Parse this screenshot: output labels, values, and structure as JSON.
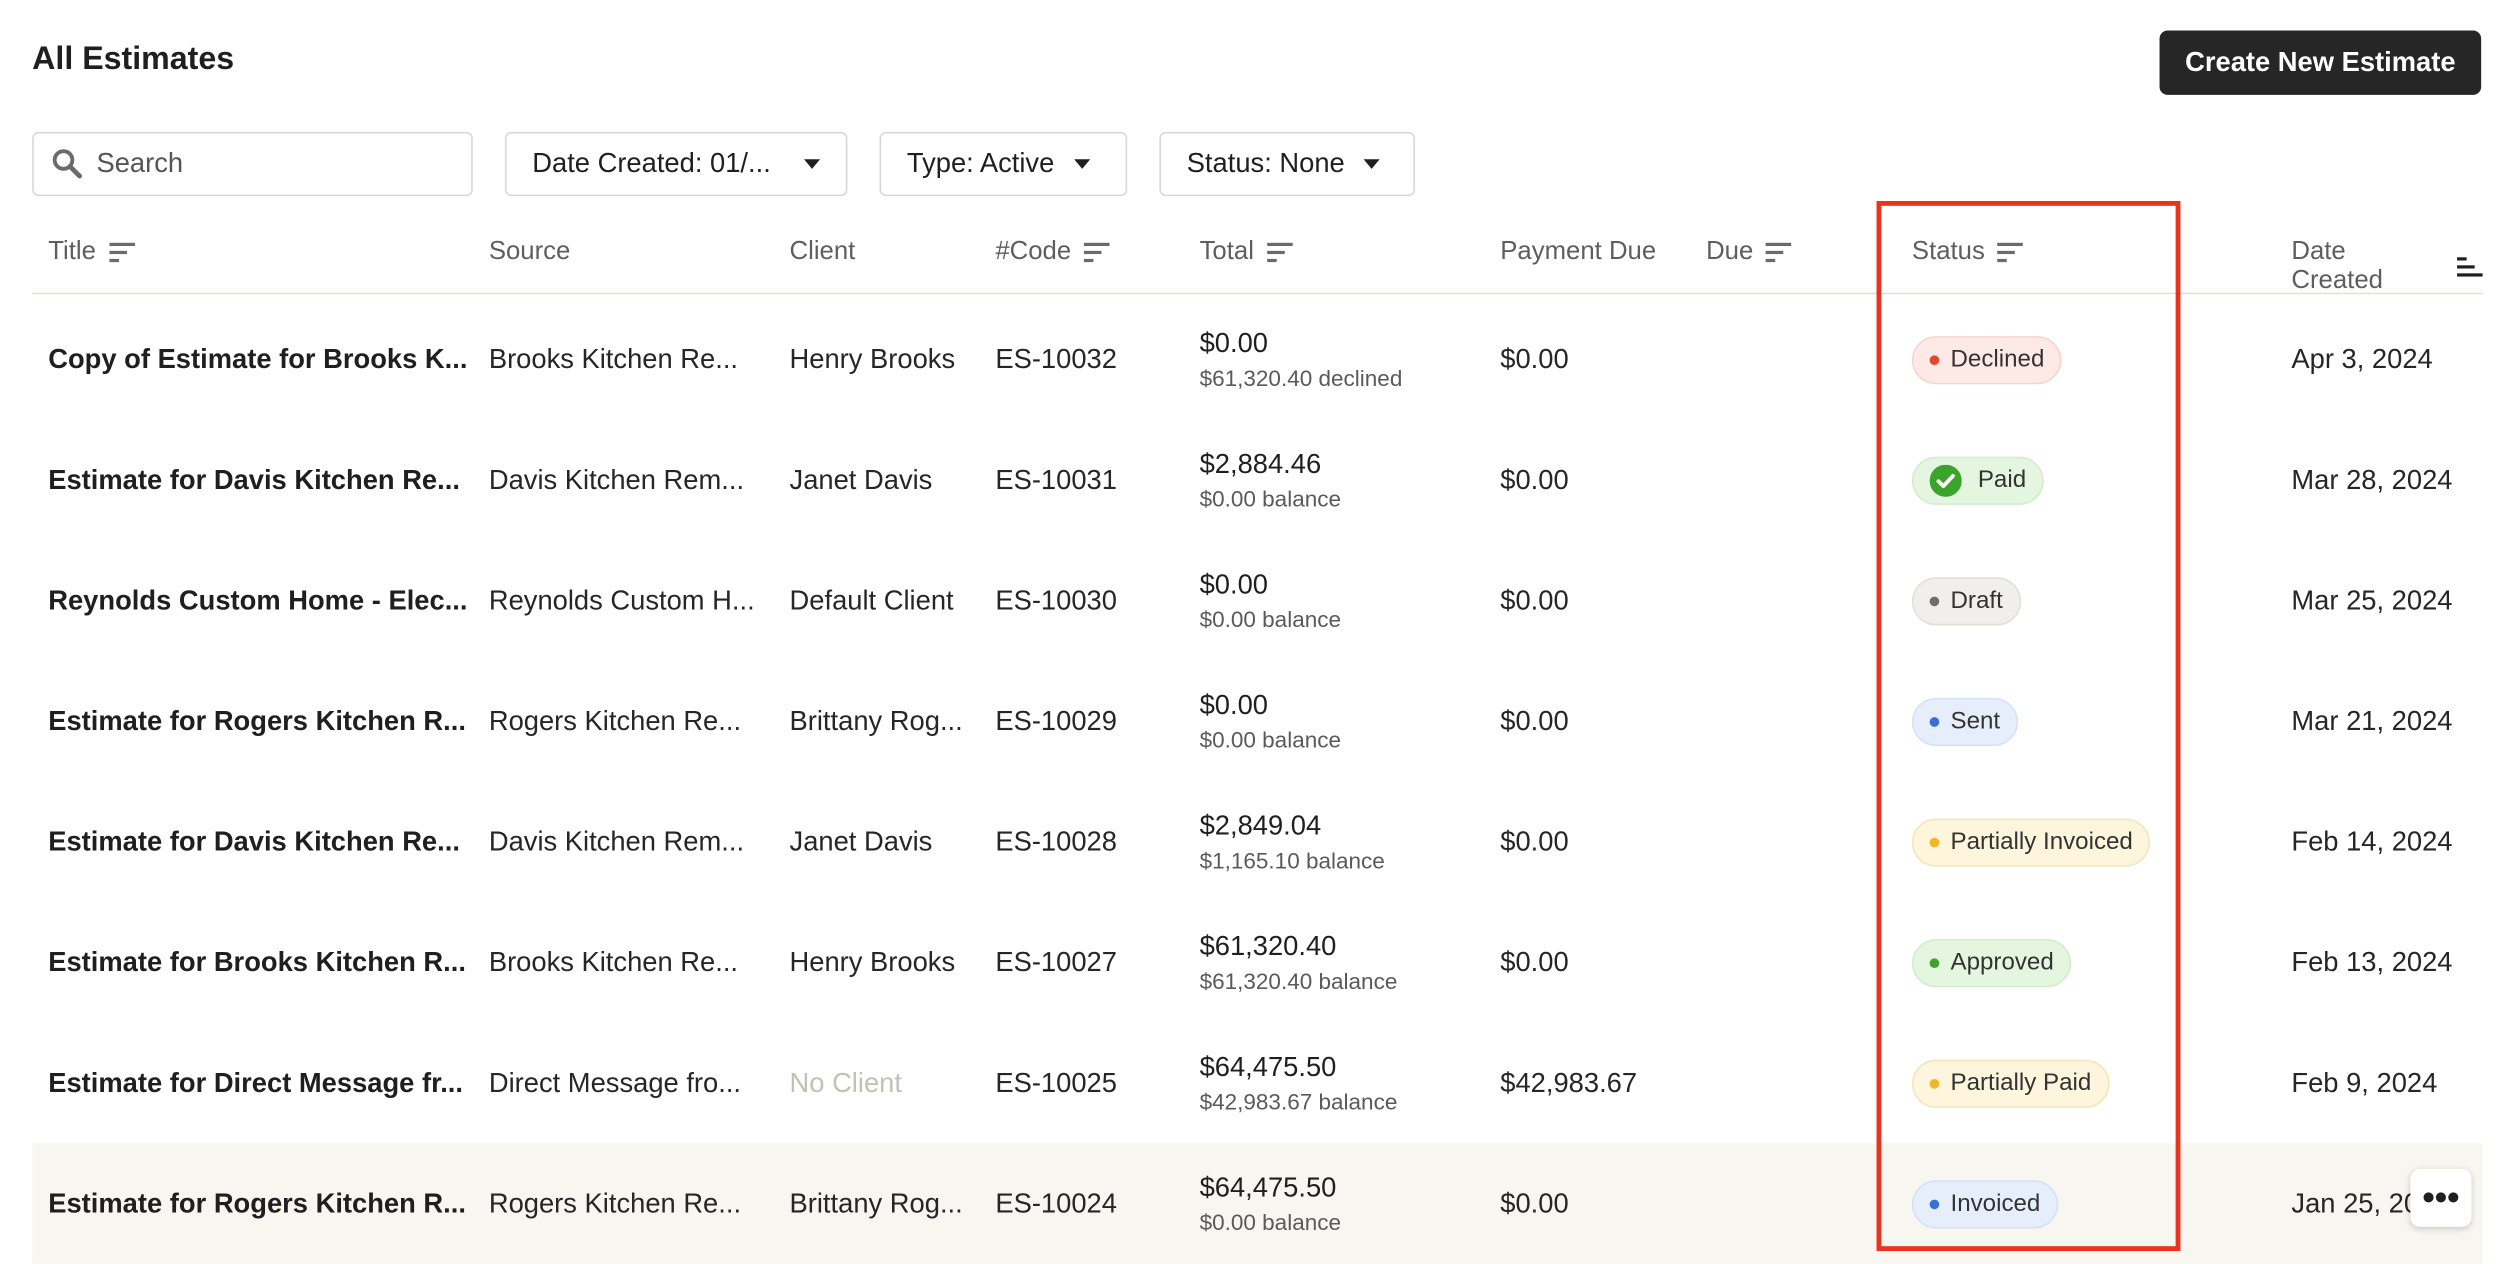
{
  "header": {
    "title": "All Estimates",
    "create_label": "Create New Estimate"
  },
  "search": {
    "placeholder": "Search"
  },
  "filters": {
    "date": "Date Created: 01/...",
    "type": "Type: Active",
    "status": "Status: None"
  },
  "columns": {
    "title": "Title",
    "source": "Source",
    "client": "Client",
    "code": "#Code",
    "total": "Total",
    "payment_due": "Payment Due",
    "due": "Due",
    "status": "Status",
    "date_created": "Date Created"
  },
  "status_colors": {
    "Declined": {
      "bg": "#fde9e6",
      "dot": "#e0482f",
      "border": "#f6d4cf"
    },
    "Paid": {
      "bg": "#e5f6e0",
      "dot": "#3ba42a",
      "border": "#d3edcb"
    },
    "Draft": {
      "bg": "#f0efeb",
      "dot": "#6d6d6d",
      "border": "#e2e0da"
    },
    "Sent": {
      "bg": "#e6eefb",
      "dot": "#3a6fd6",
      "border": "#d5e1f5"
    },
    "Partially Invoiced": {
      "bg": "#fdf5dc",
      "dot": "#f1b52a",
      "border": "#f3e6bd"
    },
    "Approved": {
      "bg": "#e5f6e0",
      "dot": "#3ba42a",
      "border": "#d3edcb"
    },
    "Partially Paid": {
      "bg": "#fdf5dc",
      "dot": "#f1b52a",
      "border": "#f3e6bd"
    },
    "Invoiced": {
      "bg": "#e6eefb",
      "dot": "#3a6fd6",
      "border": "#d5e1f5"
    }
  },
  "rows": [
    {
      "title": "Copy of Estimate for Brooks K...",
      "source": "Brooks Kitchen Re...",
      "client": "Henry Brooks",
      "client_muted": false,
      "code": "ES-10032",
      "total": "$0.00",
      "total_sub": "$61,320.40 declined",
      "payment_due": "$0.00",
      "due": "",
      "status": "Declined",
      "date": "Apr 3, 2024"
    },
    {
      "title": "Estimate for Davis Kitchen Re...",
      "source": "Davis Kitchen Rem...",
      "client": "Janet Davis",
      "client_muted": false,
      "code": "ES-10031",
      "total": "$2,884.46",
      "total_sub": "$0.00 balance",
      "payment_due": "$0.00",
      "due": "",
      "status": "Paid",
      "date": "Mar 28, 2024"
    },
    {
      "title": "Reynolds Custom Home - Elec...",
      "source": "Reynolds Custom H...",
      "client": "Default Client",
      "client_muted": false,
      "code": "ES-10030",
      "total": "$0.00",
      "total_sub": "$0.00 balance",
      "payment_due": "$0.00",
      "due": "",
      "status": "Draft",
      "date": "Mar 25, 2024"
    },
    {
      "title": "Estimate for Rogers Kitchen R...",
      "source": "Rogers Kitchen Re...",
      "client": "Brittany Rog...",
      "client_muted": false,
      "code": "ES-10029",
      "total": "$0.00",
      "total_sub": "$0.00 balance",
      "payment_due": "$0.00",
      "due": "",
      "status": "Sent",
      "date": "Mar 21, 2024"
    },
    {
      "title": "Estimate for Davis Kitchen Re...",
      "source": "Davis Kitchen Rem...",
      "client": "Janet Davis",
      "client_muted": false,
      "code": "ES-10028",
      "total": "$2,849.04",
      "total_sub": "$1,165.10 balance",
      "payment_due": "$0.00",
      "due": "",
      "status": "Partially Invoiced",
      "date": "Feb 14, 2024"
    },
    {
      "title": "Estimate for Brooks Kitchen R...",
      "source": "Brooks Kitchen Re...",
      "client": "Henry Brooks",
      "client_muted": false,
      "code": "ES-10027",
      "total": "$61,320.40",
      "total_sub": "$61,320.40 balance",
      "payment_due": "$0.00",
      "due": "",
      "status": "Approved",
      "date": "Feb 13, 2024"
    },
    {
      "title": "Estimate for Direct Message fr...",
      "source": "Direct Message fro...",
      "client": "No Client",
      "client_muted": true,
      "code": "ES-10025",
      "total": "$64,475.50",
      "total_sub": "$42,983.67 balance",
      "payment_due": "$42,983.67",
      "due": "",
      "status": "Partially Paid",
      "date": "Feb 9, 2024"
    },
    {
      "title": "Estimate for Rogers Kitchen R...",
      "source": "Rogers Kitchen Re...",
      "client": "Brittany Rog...",
      "client_muted": false,
      "code": "ES-10024",
      "total": "$64,475.50",
      "total_sub": "$0.00 balance",
      "payment_due": "$0.00",
      "due": "",
      "status": "Invoiced",
      "date": "Jan 25, 20"
    }
  ],
  "highlight_color": "#e8341f",
  "more_icon": "ellipsis-icon"
}
